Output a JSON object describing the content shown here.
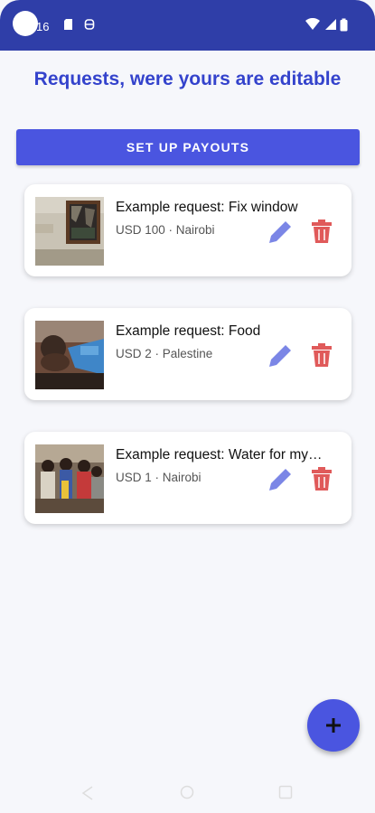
{
  "status_bar": {
    "time": "16"
  },
  "title": "Requests, were yours are editable",
  "payout_button": "SET UP PAYOUTS",
  "requests": [
    {
      "title": "Example request: Fix window",
      "subtitle": "USD 100 · Nairobi",
      "image": "broken-window-photo"
    },
    {
      "title": "Example request: Food",
      "subtitle": "USD 2 · Palestine",
      "image": "children-photo"
    },
    {
      "title": "Example request: Water for my…",
      "subtitle": "USD 1 · Nairobi",
      "image": "children-group-photo"
    }
  ],
  "colors": {
    "accent": "#4a55e0",
    "title": "#3443cc",
    "edit": "#7b86e6",
    "delete": "#e05a5a",
    "status_bar": "#2f3ea8"
  },
  "icons": {
    "add": "plus-icon",
    "edit": "pencil-icon",
    "delete": "trash-icon"
  }
}
